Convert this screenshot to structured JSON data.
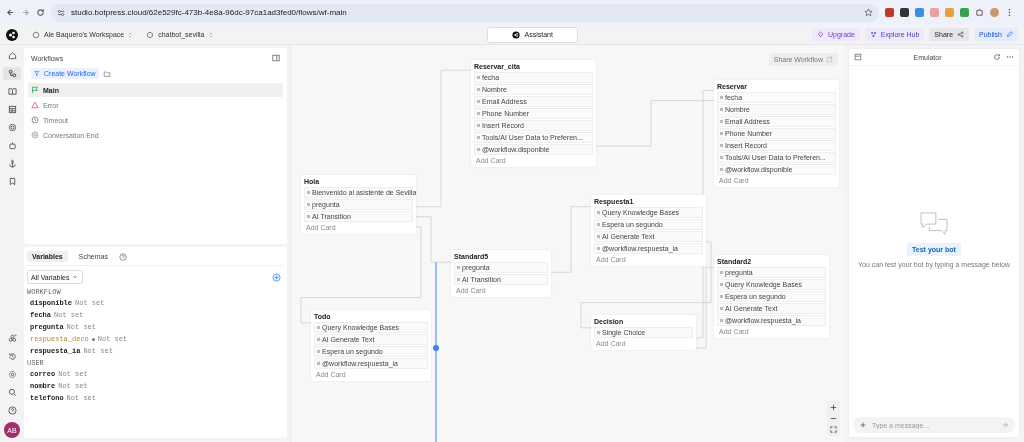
{
  "browser": {
    "url": "studio.botpress.cloud/62e529fc-473b-4e8a-96dc-97ca1ad3fed0/flows/wf-main"
  },
  "header": {
    "workspace": "Ale Baquero's Workspace",
    "bot": "chatbot_sevilla",
    "assistant": "Assistant",
    "buttons": [
      {
        "label": "Upgrade",
        "kind": "upgrade"
      },
      {
        "label": "Explore Hub",
        "kind": "hub"
      },
      {
        "label": "Share",
        "kind": "share"
      },
      {
        "label": "Publish",
        "kind": "publish"
      }
    ]
  },
  "avatar": "AB",
  "workflows": {
    "title": "Workflows",
    "create": "Create Workflow",
    "items": [
      {
        "label": "Main",
        "kind": "flag",
        "selected": true
      },
      {
        "label": "Error",
        "kind": "warning",
        "selected": false
      },
      {
        "label": "Timeout",
        "kind": "clock",
        "selected": false
      },
      {
        "label": "Conversation End",
        "kind": "end",
        "selected": false
      }
    ]
  },
  "variables": {
    "tabs": [
      {
        "label": "Variables",
        "selected": true
      },
      {
        "label": "Schemas",
        "selected": false
      }
    ],
    "filter": "All Variables",
    "groups": [
      {
        "title": "WORKFLOW",
        "vars": [
          {
            "name": "disponible",
            "value": "Not set",
            "muted": false
          },
          {
            "name": "fecha",
            "value": "Not set",
            "muted": false
          },
          {
            "name": "pregunta",
            "value": "Not set",
            "muted": false
          },
          {
            "name": "respuesta_deco",
            "value": "Not set",
            "muted": true
          },
          {
            "name": "respuesta_ia",
            "value": "Not set",
            "muted": false
          }
        ]
      },
      {
        "title": "USER",
        "vars": [
          {
            "name": "correo",
            "value": "Not set",
            "muted": false
          },
          {
            "name": "nombre",
            "value": "Not set",
            "muted": false
          },
          {
            "name": "telefono",
            "value": "Not set",
            "muted": false
          }
        ]
      }
    ]
  },
  "canvas": {
    "share": "Share Workflow",
    "nodes": [
      {
        "title": "Hola",
        "cards": [
          "Bienvenido al asistente de Sevilla",
          "pregunta",
          "AI Transition"
        ],
        "add": "Add Card"
      },
      {
        "title": "Reservar_cita",
        "cards": [
          "fecha",
          "Nombre",
          "Email Address",
          "Phone Number",
          "Insert Record",
          "Tools/AI User Data to Preferen...",
          "@workflow.disponible"
        ],
        "add": "Add Card"
      },
      {
        "title": "Standard5",
        "cards": [
          "pregunta",
          "AI Transition"
        ],
        "add": "Add Card"
      },
      {
        "title": "Todo",
        "cards": [
          "Query Knowledge Bases",
          "AI Generate Text",
          "Espera un segundo",
          "@workflow.respuesta_ia"
        ],
        "add": "Add Card"
      },
      {
        "title": "Respuesta1",
        "cards": [
          "Query Knowledge Bases",
          "Espera un segundo",
          "AI Generate Text",
          "@workflow.respuesta_ia"
        ],
        "add": "Add Card"
      },
      {
        "title": "Decision",
        "cards": [
          "Single Choice"
        ],
        "add": "Add Card"
      },
      {
        "title": "Reservar",
        "cards": [
          "fecha",
          "Nombre",
          "Email Address",
          "Phone Number",
          "Insert Record",
          "Tools/AI User Data to Preferen...",
          "@workflow.disponible"
        ],
        "add": "Add Card"
      },
      {
        "title": "Standard2",
        "cards": [
          "pregunta",
          "Query Knowledge Bases",
          "Espera un segundo",
          "AI Generate Text",
          "@workflow.respuesta_ia"
        ],
        "add": "Add Card"
      }
    ]
  },
  "emulator": {
    "title": "Emulator",
    "empty_title": "Test your bot",
    "empty_text": "You can test your bot by typing a message below",
    "placeholder": "Type a message..."
  }
}
